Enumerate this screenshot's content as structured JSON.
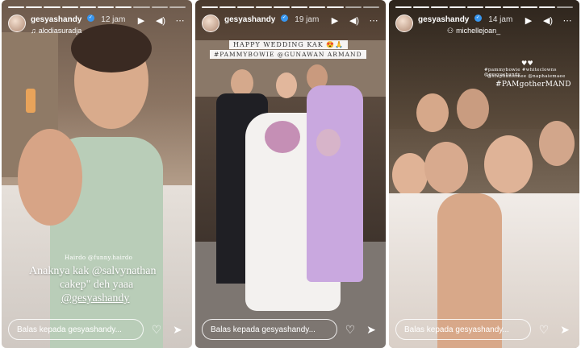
{
  "stories": [
    {
      "username": "gesyashandy",
      "time": "12 jam",
      "sub": "alodiasuradja",
      "sub_icon": "music-note-icon",
      "captions": [
        "Hairdo @funny.hairdo",
        "Anaknya kak @salvynathan",
        "cakep\" deh yaaa",
        "@gesyashandy"
      ],
      "reply_placeholder": "Balas kepada gesyashandy..."
    },
    {
      "username": "gesyashandy",
      "time": "19 jam",
      "captions": [
        "HAPPY WEDDING KAK 😍🙏",
        "#PAMMYBOWIE @GUNAWAN ARMAND"
      ],
      "reply_placeholder": "Balas kepada gesyashandy..."
    },
    {
      "username": "gesyashandy",
      "time": "14 jam",
      "sub": "michellejoan_",
      "sub_icon": "tag-icon",
      "captions": [
        "♥♥",
        "#pammybowie #whiteclowns @gesyashandy",
        "@stephaniemee @naphaiemaee",
        "#PAMgotherMAND"
      ],
      "reply_placeholder": "Balas kepada gesyashandy..."
    }
  ],
  "icons": {
    "play": "▶",
    "volume": "🔊",
    "more": "⋯",
    "heart": "♡",
    "send": "➤"
  }
}
